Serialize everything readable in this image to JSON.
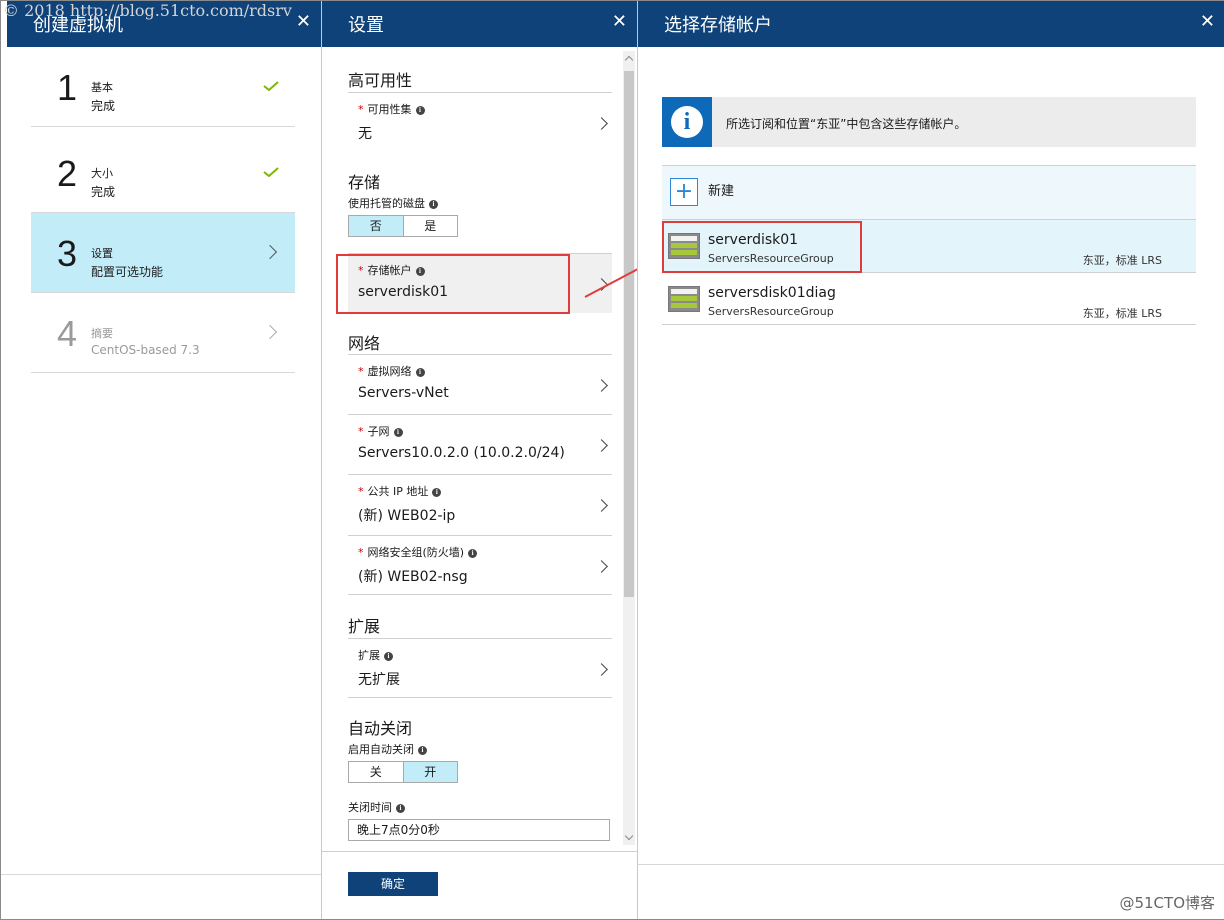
{
  "watermark": "© 2018 http://blog.51cto.com/rdsrv",
  "blade1": {
    "title": "创建虚拟机",
    "close": "✕",
    "steps": [
      {
        "num": "1",
        "label": "基本",
        "status": "完成"
      },
      {
        "num": "2",
        "label": "大小",
        "status": "完成"
      },
      {
        "num": "3",
        "label": "设置",
        "status": "配置可选功能"
      },
      {
        "num": "4",
        "label": "摘要",
        "status": "CentOS-based 7.3"
      }
    ]
  },
  "blade2": {
    "title": "设置",
    "close": "✕",
    "ha_section": "高可用性",
    "availability_set": {
      "label": "可用性集",
      "value": "无"
    },
    "storage_section": "存储",
    "managed_disk_label": "使用托管的磁盘",
    "managed_disk_options": [
      "否",
      "是"
    ],
    "storage_account": {
      "label": "存储帐户",
      "value": "serverdisk01"
    },
    "network_section": "网络",
    "vnet": {
      "label": "虚拟网络",
      "value": "Servers-vNet"
    },
    "subnet": {
      "label": "子网",
      "value": "Servers10.0.2.0 (10.0.2.0/24)"
    },
    "public_ip": {
      "label": "公共 IP 地址",
      "value": "(新) WEB02-ip"
    },
    "nsg": {
      "label": "网络安全组(防火墙)",
      "value": "(新) WEB02-nsg"
    },
    "ext_section": "扩展",
    "extensions": {
      "label": "扩展",
      "value": "无扩展"
    },
    "autoshutdown_section": "自动关闭",
    "autoshutdown_label": "启用自动关闭",
    "autoshutdown_options": [
      "关",
      "开"
    ],
    "shutdown_time_label": "关闭时间",
    "shutdown_time_value": "晚上7点0分0秒",
    "ok_button": "确定"
  },
  "blade3": {
    "title": "选择存储帐户",
    "close": "✕",
    "info_text": "所选订阅和位置“东亚”中包含这些存储帐户。",
    "new_label": "新建",
    "accounts": [
      {
        "name": "serverdisk01",
        "group": "ServersResourceGroup",
        "location": "东亚，标准 LRS"
      },
      {
        "name": "serversdisk01diag",
        "group": "ServersResourceGroup",
        "location": "东亚，标准 LRS"
      }
    ]
  },
  "credit": "@51CTO博客",
  "colors": {
    "header": "#0e4279",
    "selected": "#c3ecf9",
    "check": "#7cb800",
    "highlight": "#e03c3c"
  }
}
